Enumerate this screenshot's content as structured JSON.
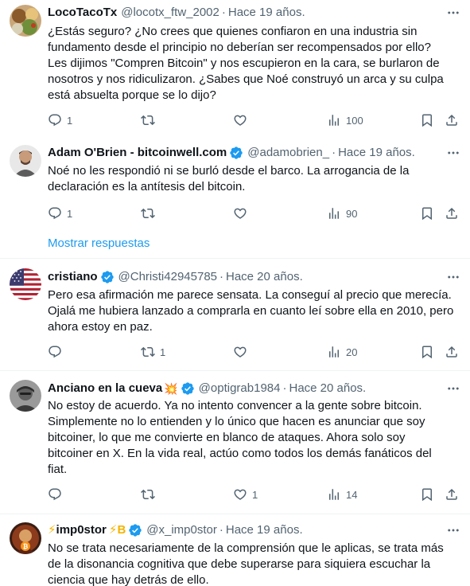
{
  "tweets": [
    {
      "display_name": "LocoTacoTx",
      "verified": false,
      "handle": "@locotx_ftw_2002",
      "dot": "·",
      "time": "Hace 19 años.",
      "lines": [
        "¿Estás seguro? ¿No crees que quienes confiaron en una industria sin",
        "fundamento desde el principio no deberían ser recompensados por ello?",
        "Les dijimos \"Compren Bitcoin\" y nos escupieron en la cara, se burlaron de",
        "nosotros y nos ridiculizaron. ¿Sabes que Noé construyó un arca y su culpa",
        "está absuelta porque se lo dijo?"
      ],
      "replies": "1",
      "retweets": "",
      "likes": "",
      "views": "100"
    },
    {
      "display_name": "Adam O'Brien - bitcoinwell.com",
      "verified": true,
      "handle": "@adamobrien_",
      "dot": "·",
      "time": "Hace 19 años.",
      "lines": [
        "Noé no les respondió ni se burló desde el barco. La arrogancia de la",
        "declaración es la antítesis del bitcoin."
      ],
      "replies": "1",
      "retweets": "",
      "likes": "",
      "views": "90"
    },
    {
      "display_name": "cristiano",
      "verified": true,
      "handle": "@Christi42945785",
      "dot": "·",
      "time": "Hace 20 años.",
      "lines": [
        "Pero esa afirmación me parece sensata. La conseguí al precio que merecía.",
        "Ojalá me hubiera lanzado a comprarla en cuanto leí sobre ella en 2010, pero",
        "ahora estoy en paz."
      ],
      "replies": "",
      "retweets": "1",
      "likes": "",
      "views": "20"
    },
    {
      "display_name": "Anciano en la cueva",
      "name_emoji": "💥",
      "verified": true,
      "handle": "@optigrab1984",
      "dot": "·",
      "time": "Hace 20 años.",
      "lines": [
        "No estoy de acuerdo. Ya no intento convencer a la gente sobre bitcoin.",
        "Simplemente no lo entienden y lo único que hacen es anunciar que soy",
        "bitcoiner, lo que me convierte en blanco de ataques. Ahora solo soy",
        "bitcoiner en X. En la vida real, actúo como todos los demás fanáticos del",
        "fiat."
      ],
      "replies": "",
      "retweets": "",
      "likes": "1",
      "views": "14"
    },
    {
      "name_prefix": "⚡",
      "display_name": "imp0stor",
      "name_suffix": "⚡B",
      "verified": true,
      "handle": "@x_imp0stor",
      "dot": "·",
      "time": "Hace 19 años.",
      "lines": [
        "No se trata necesariamente de la comprensión que le aplicas, se trata más",
        "de la disonancia cognitiva que debe superarse para siquiera escuchar la",
        "ciencia que hay detrás de ello."
      ]
    }
  ],
  "show_replies_label": "Mostrar respuestas",
  "icons": {
    "reply": "reply-icon",
    "retweet": "retweet-icon",
    "like": "heart-icon",
    "views": "views-icon",
    "bookmark": "bookmark-icon",
    "share": "share-icon",
    "more": "more-icon",
    "verified": "verified-badge-icon"
  },
  "colors": {
    "text": "#0f1419",
    "secondary": "#536471",
    "link": "#1d9bf0",
    "verified": "#1d9bf0",
    "divider": "#eff3f4"
  }
}
